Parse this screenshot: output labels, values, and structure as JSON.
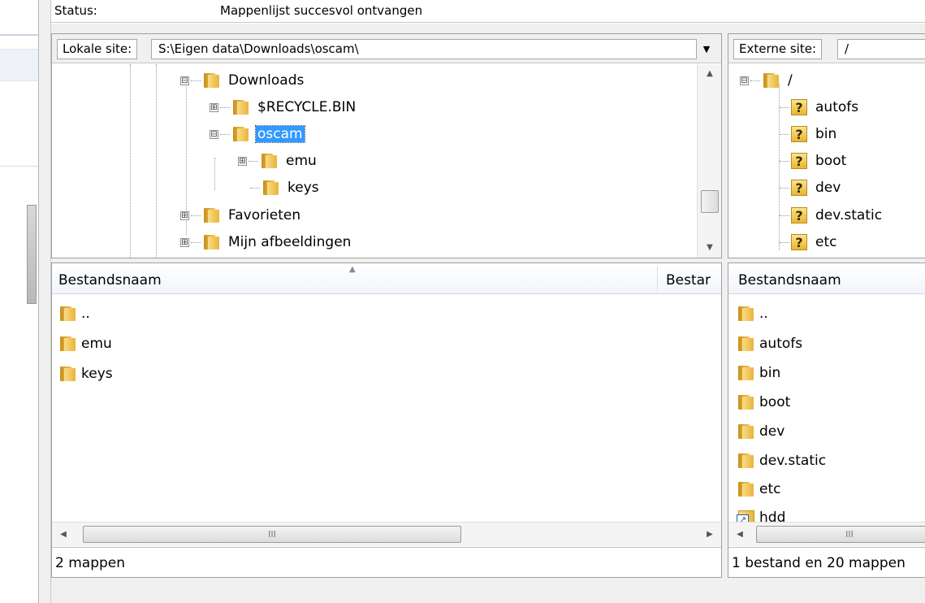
{
  "status_log": {
    "label": "Status:",
    "message": "Mappenlijst succesvol ontvangen"
  },
  "local": {
    "site_label": "Lokale site:",
    "path": "S:\\Eigen data\\Downloads\\oscam\\",
    "tree": [
      {
        "label": "Downloads",
        "toggle": "⊟",
        "icon": "folder-icon"
      },
      {
        "label": "$RECYCLE.BIN",
        "toggle": "⊞",
        "icon": "folder-icon"
      },
      {
        "label": "oscam",
        "toggle": "⊟",
        "icon": "folder-icon",
        "selected": true
      },
      {
        "label": "emu",
        "toggle": "⊞",
        "icon": "folder-icon"
      },
      {
        "label": "keys",
        "toggle": "",
        "icon": "folder-icon"
      },
      {
        "label": "Favorieten",
        "toggle": "⊞",
        "icon": "folder-icon"
      },
      {
        "label": "Mijn afbeeldingen",
        "toggle": "⊞",
        "icon": "folder-icon"
      }
    ],
    "columns": [
      "Bestandsnaam",
      "Bestar"
    ],
    "files": [
      "..",
      "emu",
      "keys"
    ],
    "scroll_thumb": "III",
    "status": "2 mappen"
  },
  "remote": {
    "site_label": "Externe site:",
    "path": "/",
    "tree": [
      {
        "label": "/",
        "toggle": "⊟",
        "icon": "folder-icon"
      },
      {
        "label": "autofs",
        "icon": "unknown-folder-icon"
      },
      {
        "label": "bin",
        "icon": "unknown-folder-icon"
      },
      {
        "label": "boot",
        "icon": "unknown-folder-icon"
      },
      {
        "label": "dev",
        "icon": "unknown-folder-icon"
      },
      {
        "label": "dev.static",
        "icon": "unknown-folder-icon"
      },
      {
        "label": "etc",
        "icon": "unknown-folder-icon"
      }
    ],
    "unknown_glyph": "?",
    "columns": [
      "Bestandsnaam"
    ],
    "files": [
      {
        "name": "..",
        "icon": "folder-icon"
      },
      {
        "name": "autofs",
        "icon": "folder-icon"
      },
      {
        "name": "bin",
        "icon": "folder-icon"
      },
      {
        "name": "boot",
        "icon": "folder-icon"
      },
      {
        "name": "dev",
        "icon": "folder-icon"
      },
      {
        "name": "dev.static",
        "icon": "folder-icon"
      },
      {
        "name": "etc",
        "icon": "folder-icon"
      },
      {
        "name": "hdd",
        "icon": "symlink-folder-icon"
      }
    ],
    "scroll_thumb": "III",
    "status": "1 bestand en 20 mappen"
  }
}
